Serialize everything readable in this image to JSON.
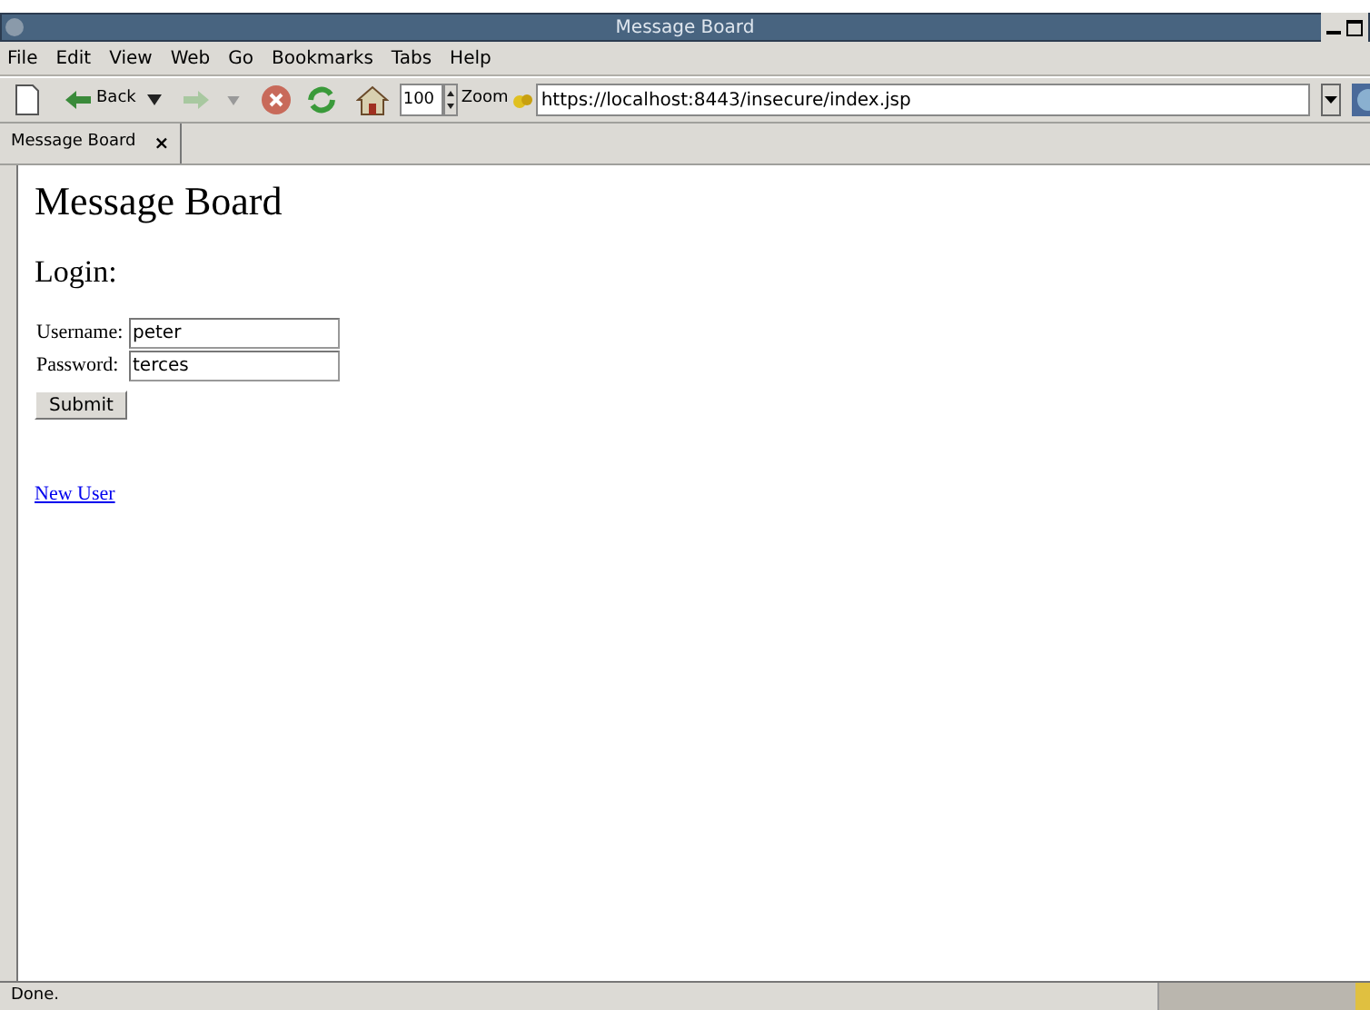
{
  "window": {
    "title": "Message Board"
  },
  "menu": [
    "File",
    "Edit",
    "View",
    "Web",
    "Go",
    "Bookmarks",
    "Tabs",
    "Help"
  ],
  "toolbar": {
    "back_label": "Back",
    "zoom_value": "100",
    "zoom_label": "Zoom",
    "url": "https://localhost:8443/insecure/index.jsp"
  },
  "tabs": [
    {
      "label": "Message Board",
      "close": "×",
      "selected": true
    }
  ],
  "page": {
    "heading": "Message Board",
    "subheading": "Login:",
    "fields": [
      {
        "label": "Username:",
        "value": "peter"
      },
      {
        "label": "Password:",
        "value": "terces"
      }
    ],
    "submit": "Submit",
    "link": "New User"
  },
  "status_bar": {
    "text": "Done."
  }
}
